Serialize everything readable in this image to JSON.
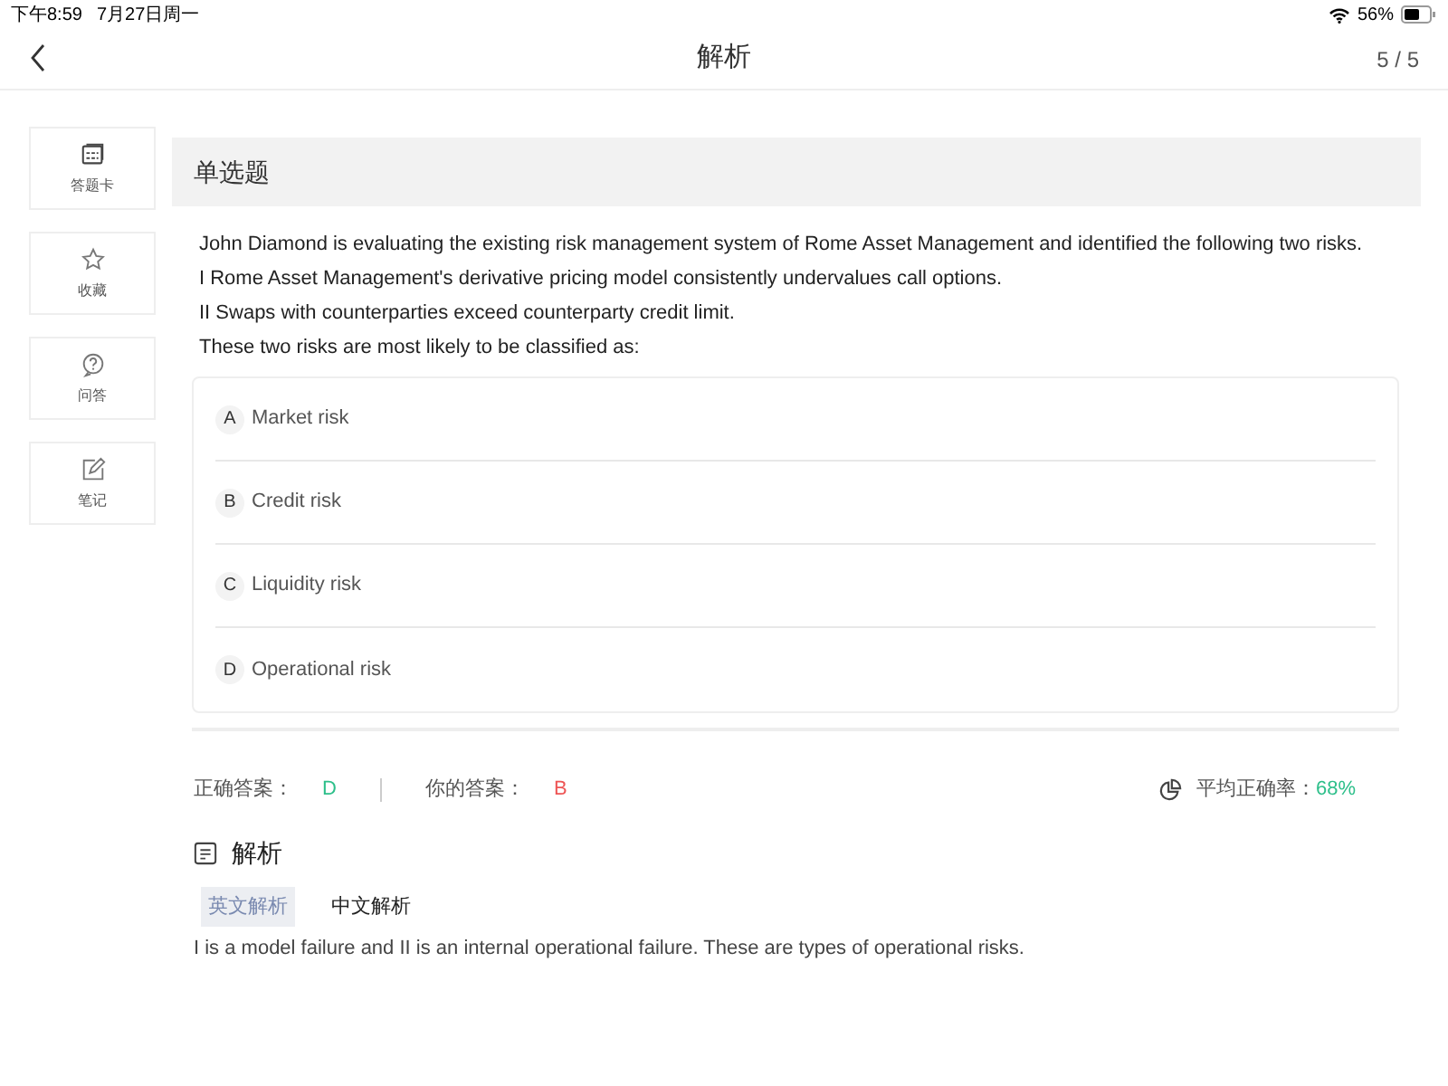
{
  "status_bar": {
    "time": "下午8:59",
    "date": "7月27日周一",
    "battery": "56%"
  },
  "header": {
    "title": "解析",
    "progress": "5 / 5"
  },
  "sidebar": {
    "items": [
      {
        "kind": "card",
        "label": "答题卡"
      },
      {
        "kind": "star",
        "label": "收藏"
      },
      {
        "kind": "question",
        "label": "问答"
      },
      {
        "kind": "note",
        "label": "笔记"
      }
    ]
  },
  "question": {
    "type": "单选题",
    "lines": [
      "John Diamond is evaluating the existing risk management system of Rome Asset Management and identified the following two risks.",
      "I Rome Asset Management's derivative pricing model consistently undervalues call options.",
      "II Swaps with counterparties exceed counterparty credit limit.",
      "These two risks are most likely to be classified as:"
    ],
    "options": [
      {
        "letter": "A",
        "text": "Market risk"
      },
      {
        "letter": "B",
        "text": "Credit risk"
      },
      {
        "letter": "C",
        "text": "Liquidity risk"
      },
      {
        "letter": "D",
        "text": "Operational risk"
      }
    ]
  },
  "result": {
    "correct_label": "正确答案：",
    "correct": "D",
    "yours_label": "你的答案：",
    "yours": "B",
    "rate_label": "平均正确率：",
    "rate": "68%"
  },
  "analysis": {
    "title": "解析",
    "tabs": [
      {
        "label": "英文解析",
        "selected": true
      },
      {
        "label": "中文解析",
        "selected": false
      }
    ],
    "text": "I is a model failure and II is an internal operational failure. These are types of operational risks."
  }
}
